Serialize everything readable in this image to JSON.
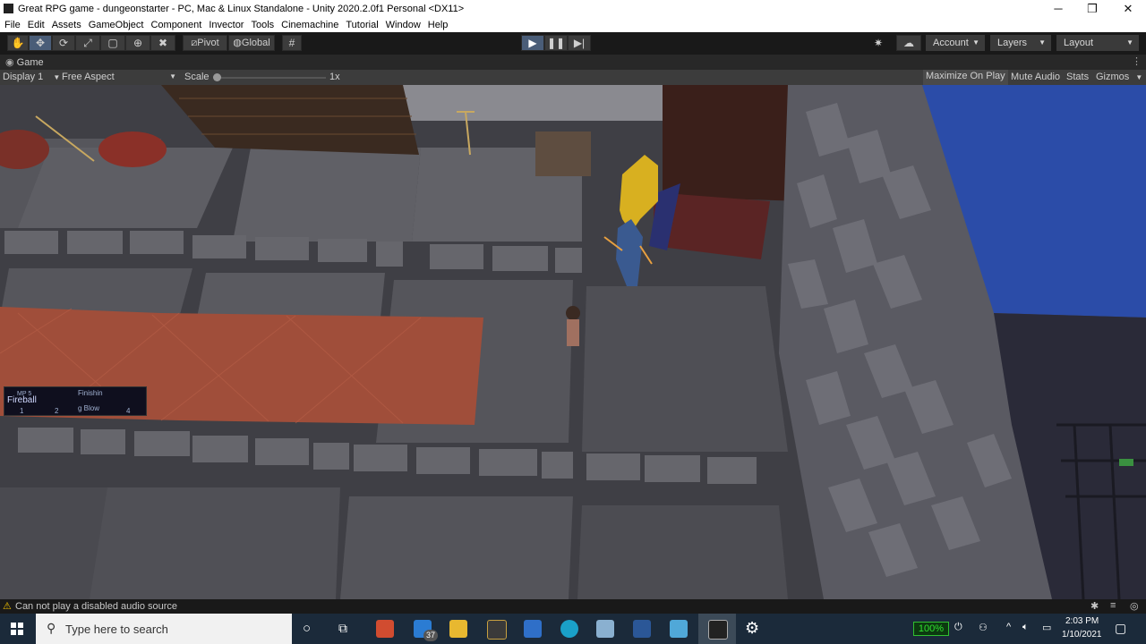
{
  "window": {
    "title": "Great RPG game - dungeonstarter - PC, Mac & Linux Standalone - Unity 2020.2.0f1 Personal <DX11>",
    "minimize": "─",
    "maximize": "❐",
    "close": "✕"
  },
  "menu": [
    "File",
    "Edit",
    "Assets",
    "GameObject",
    "Component",
    "Invector",
    "Tools",
    "Cinemachine",
    "Tutorial",
    "Window",
    "Help"
  ],
  "toolbar": {
    "pivot_label": "Pivot",
    "global_label": "Global",
    "account_label": "Account",
    "layers_label": "Layers",
    "layout_label": "Layout"
  },
  "game_view": {
    "tab_label": "Game",
    "display_label": "Display 1",
    "aspect_label": "Free Aspect",
    "scale_label": "Scale",
    "scale_value": "1x",
    "maximize_on_play": "Maximize On Play",
    "mute_audio": "Mute Audio",
    "stats": "Stats",
    "gizmos": "Gizmos"
  },
  "hotbar": {
    "slot1_mp": "MP 5",
    "slot1_name": "Fireball",
    "slot1_key": "1",
    "slot2_key": "2",
    "slot3_name_line1": "Finishin",
    "slot3_name_line2": "g Blow",
    "slot4_key": "4"
  },
  "console": {
    "message": "Can not play a disabled audio source"
  },
  "taskbar": {
    "search_placeholder": "Type here to search",
    "mail_badge": "37",
    "battery": "100%",
    "time": "2:03 PM",
    "date": "1/10/2021"
  },
  "colors": {
    "play_active": "#4a5d78",
    "floor": "#4c4c52",
    "carpet": "#a0503c",
    "sky": "#2a4aa0"
  }
}
